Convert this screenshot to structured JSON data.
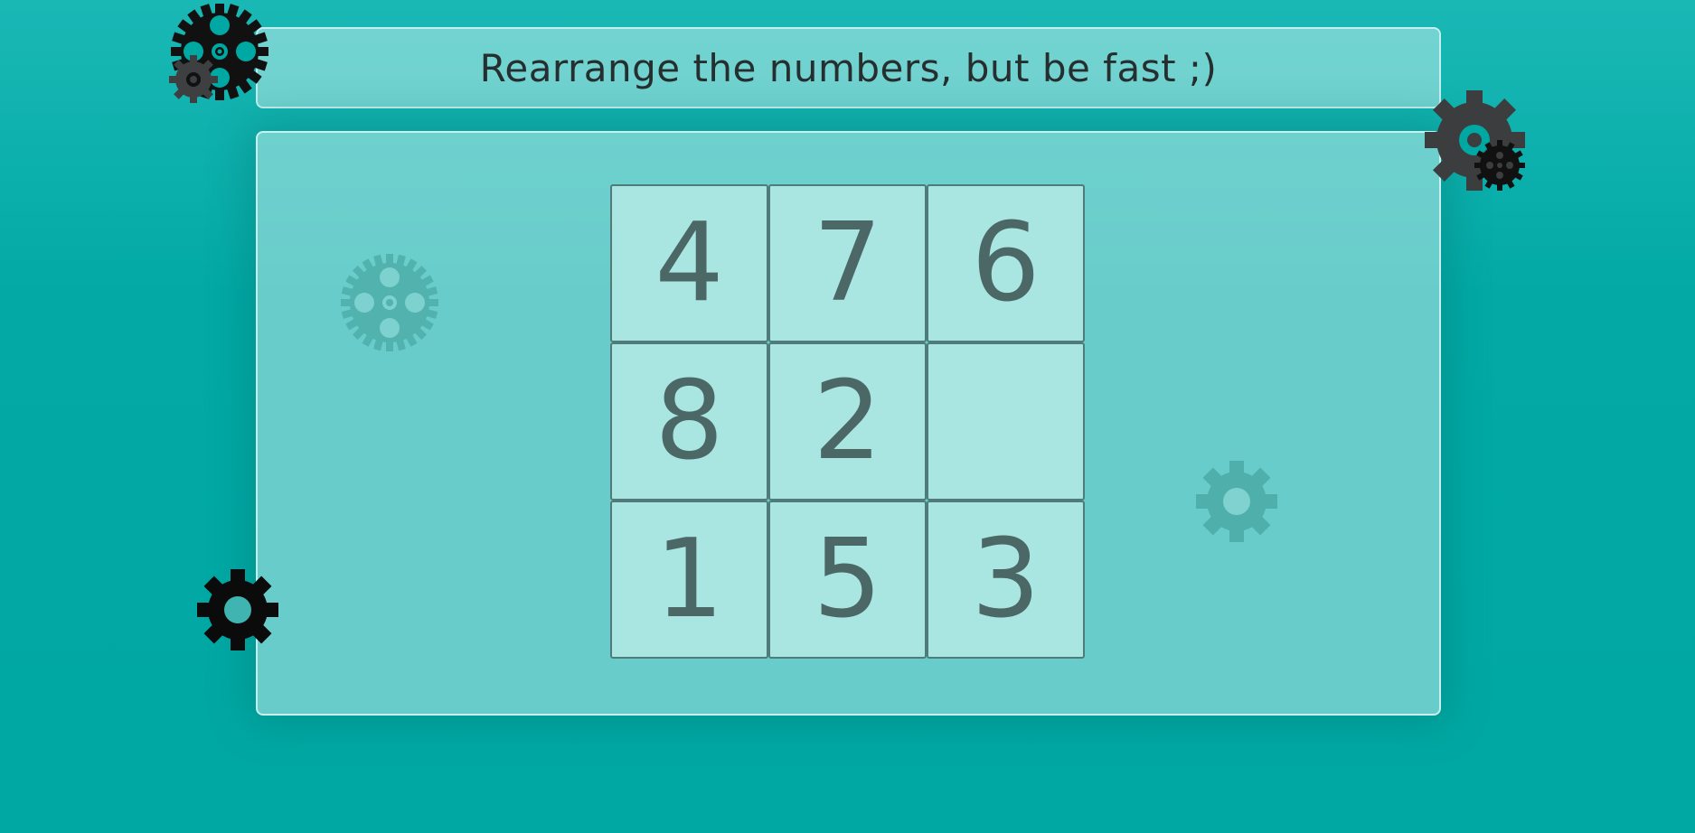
{
  "header": {
    "title": "Rearrange the numbers, but be fast ;)"
  },
  "puzzle": {
    "tiles": [
      {
        "value": "4"
      },
      {
        "value": "7"
      },
      {
        "value": "6"
      },
      {
        "value": "8"
      },
      {
        "value": "2"
      },
      {
        "value": ""
      },
      {
        "value": "1"
      },
      {
        "value": "5"
      },
      {
        "value": "3"
      }
    ]
  },
  "decorations": [
    "gear-cluster-top-left-icon",
    "gear-cluster-top-right-icon",
    "gear-faded-left-icon",
    "gear-faded-right-icon",
    "gear-bottom-left-icon"
  ],
  "colors": {
    "background": "#00a8a3",
    "panel": "#8fd6d3",
    "tile": "#a9e6e2",
    "tile_text": "#4b6867",
    "tile_border": "#4f7c7a",
    "title_text": "#262f2f"
  }
}
